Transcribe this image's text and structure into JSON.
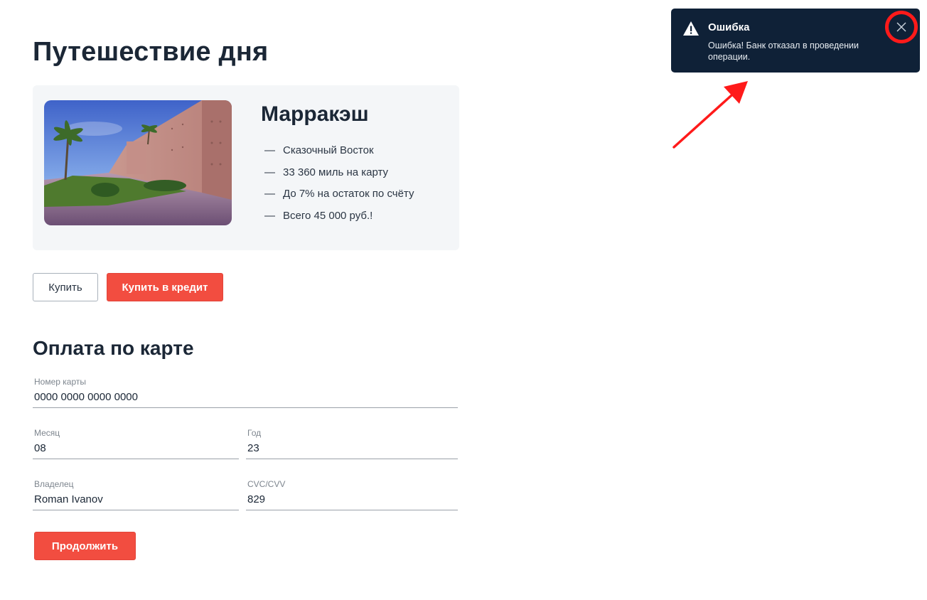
{
  "header": {
    "title": "Путешествие дня"
  },
  "offer": {
    "city": "Марракэш",
    "image_alt": "marrakesh-photo",
    "features": [
      {
        "dash": "—",
        "text": "Сказочный Восток"
      },
      {
        "dash": "—",
        "text": "33 360 миль на карту"
      },
      {
        "dash": "—",
        "text": "До 7% на остаток по счёту"
      },
      {
        "dash": "—",
        "text": "Всего 45 000 руб.!"
      }
    ]
  },
  "actions": {
    "buy_label": "Купить",
    "credit_label": "Купить в кредит"
  },
  "payment": {
    "title": "Оплата по карте",
    "card_number": {
      "label": "Номер карты",
      "value": "0000 0000 0000 0000"
    },
    "month": {
      "label": "Месяц",
      "value": "08"
    },
    "year": {
      "label": "Год",
      "value": "23"
    },
    "owner": {
      "label": "Владелец",
      "value": "Roman Ivanov"
    },
    "cvc": {
      "label": "CVC/CVV",
      "value": "829"
    },
    "continue_label": "Продолжить"
  },
  "notification": {
    "title": "Ошибка",
    "message": "Ошибка! Банк отказал в проведении операции.",
    "icon": "warning-icon",
    "close_icon": "close-icon"
  },
  "colors": {
    "accent": "#f24d40",
    "toast_bg": "#0f2137",
    "card_bg": "#f4f6f8",
    "annotation": "#ff1a1a"
  }
}
